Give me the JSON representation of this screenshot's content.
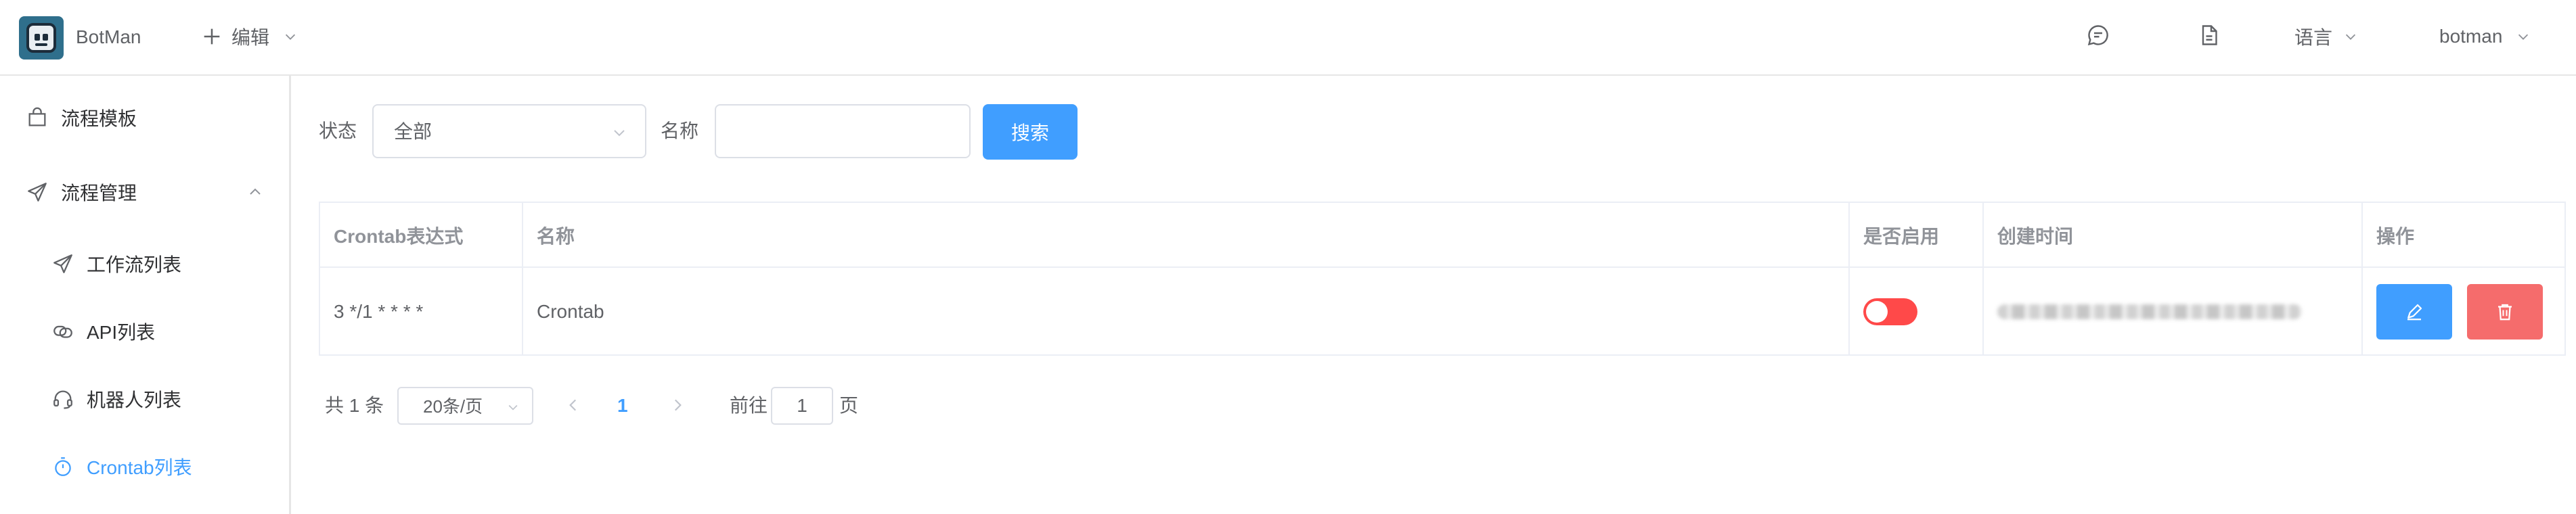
{
  "header": {
    "app_name": "BotMan",
    "edit_menu_label": "编辑",
    "language_label": "语言",
    "user_name": "botman",
    "icons": [
      "message-icon",
      "document-icon"
    ]
  },
  "sidebar": {
    "items": [
      {
        "label": "流程模板",
        "icon": "bag-icon",
        "level": "top"
      },
      {
        "label": "流程管理",
        "icon": "send-icon",
        "level": "top",
        "expanded": true
      },
      {
        "label": "工作流列表",
        "icon": "send-icon",
        "level": "sub"
      },
      {
        "label": "API列表",
        "icon": "link-icon",
        "level": "sub"
      },
      {
        "label": "机器人列表",
        "icon": "headset-icon",
        "level": "sub"
      },
      {
        "label": "Crontab列表",
        "icon": "timer-icon",
        "level": "sub",
        "active": true
      }
    ]
  },
  "filters": {
    "status_label": "状态",
    "status_value": "全部",
    "name_label": "名称",
    "name_value": "",
    "search_button": "搜索"
  },
  "table": {
    "columns": [
      "Crontab表达式",
      "名称",
      "是否启用",
      "创建时间",
      "操作"
    ],
    "rows": [
      {
        "crontab": "3 */1 * * * *",
        "name": "Crontab",
        "enabled": false
      }
    ]
  },
  "pagination": {
    "total_text": "共 1 条",
    "page_size": "20条/页",
    "current_page": "1",
    "goto_label": "前往",
    "goto_value": "1",
    "page_suffix": "页"
  },
  "colors": {
    "primary": "#409eff",
    "danger": "#f56c6c",
    "switch_off": "#ff4949"
  }
}
